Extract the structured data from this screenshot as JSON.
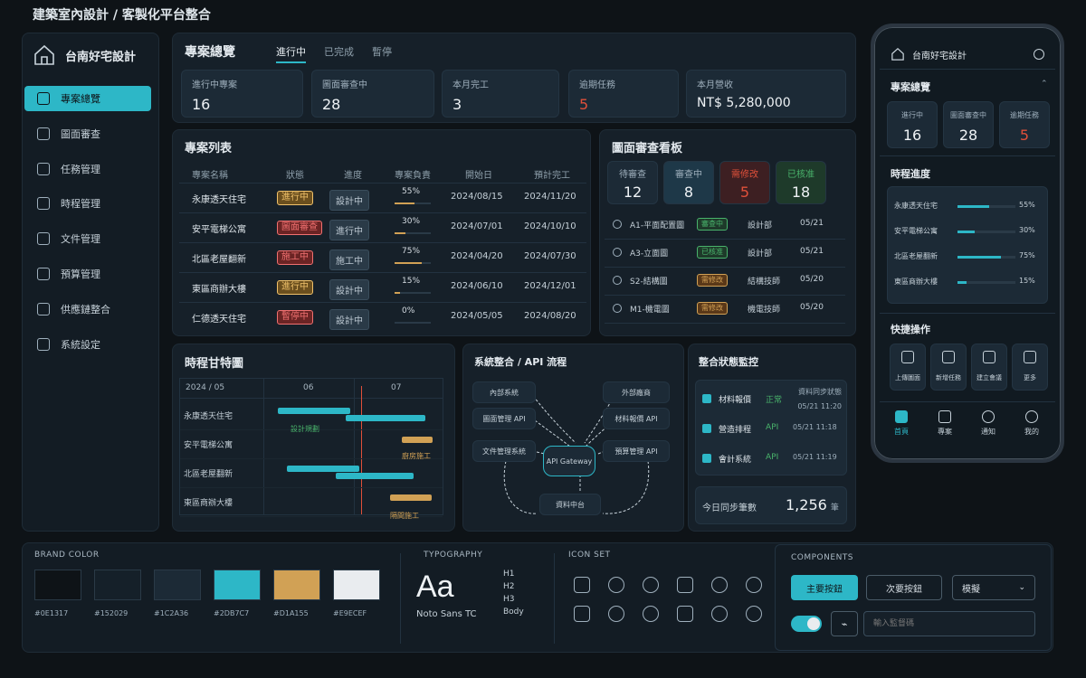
{
  "app": {
    "title": "建築室內設計 / 客製化平台整合"
  },
  "brand": {
    "name": "台南好宅設計"
  },
  "sidebar": {
    "items": [
      {
        "label": "專案總覽",
        "active": true,
        "icon": "dashboard-icon"
      },
      {
        "label": "圖面審查",
        "icon": "document-icon"
      },
      {
        "label": "任務管理",
        "icon": "task-icon"
      },
      {
        "label": "時程管理",
        "icon": "calendar-icon"
      },
      {
        "label": "文件管理",
        "icon": "file-icon"
      },
      {
        "label": "預算管理",
        "icon": "budget-icon"
      },
      {
        "label": "供應鏈整合",
        "icon": "supply-icon"
      },
      {
        "label": "系統設定",
        "icon": "gear-icon"
      }
    ]
  },
  "overview": {
    "title": "專案總覽",
    "tabs": [
      "進行中",
      "已完成",
      "暫停"
    ],
    "stats": [
      {
        "label": "進行中專案",
        "value": "16"
      },
      {
        "label": "圖面審查中",
        "value": "28"
      },
      {
        "label": "本月完工",
        "value": "3"
      },
      {
        "label": "逾期任務",
        "value": "5"
      },
      {
        "label": "本月營收",
        "value": "NT$ 5,280,000"
      }
    ]
  },
  "project_list": {
    "title": "專案列表",
    "columns": [
      "專案名稱",
      "狀態",
      "進度",
      "專案負責",
      "開始日",
      "預計完工"
    ],
    "rows": [
      {
        "name": "永康透天住宅",
        "status": "進行中",
        "phase": "設計中",
        "progress": "55%",
        "pct": 55,
        "start": "2024/08/15",
        "end": "2024/11/20"
      },
      {
        "name": "安平電梯公寓",
        "status": "圖面審查",
        "phase": "進行中",
        "progress": "30%",
        "pct": 30,
        "start": "2024/07/01",
        "end": "2024/10/10"
      },
      {
        "name": "北區老屋翻新",
        "status": "施工中",
        "phase": "施工中",
        "progress": "75%",
        "pct": 75,
        "start": "2024/04/20",
        "end": "2024/07/30"
      },
      {
        "name": "東區商辦大樓",
        "status": "進行中",
        "phase": "設計中",
        "progress": "15%",
        "pct": 15,
        "start": "2024/06/10",
        "end": "2024/12/01"
      },
      {
        "name": "仁德透天住宅",
        "status": "暫停中",
        "phase": "設計中",
        "progress": "0%",
        "pct": 0,
        "start": "2024/05/05",
        "end": "2024/08/20"
      }
    ]
  },
  "review_board": {
    "title": "圖面審查看板",
    "counts": [
      {
        "label": "待審查",
        "value": "12"
      },
      {
        "label": "審查中",
        "value": "8"
      },
      {
        "label": "需修改",
        "value": "5"
      },
      {
        "label": "已核准",
        "value": "18"
      }
    ],
    "items": [
      {
        "code": "A1-平面配置圖",
        "tag": "審查中",
        "dept": "設計部",
        "date": "05/21"
      },
      {
        "code": "A3-立面圖",
        "tag": "已核准",
        "dept": "設計部",
        "date": "05/21"
      },
      {
        "code": "S2-結構圖",
        "tag": "需修改",
        "dept": "結構技師",
        "date": "05/20"
      },
      {
        "code": "M1-機電圖",
        "tag": "需修改",
        "dept": "機電技師",
        "date": "05/20"
      }
    ]
  },
  "gantt": {
    "title": "時程甘特圖",
    "header": [
      "2024 / 05",
      "06",
      "07"
    ],
    "rows": [
      {
        "name": "永康透天住宅",
        "label": "設計規劃"
      },
      {
        "name": "安平電梯公寓",
        "label": "廚房施工"
      },
      {
        "name": "北區老屋翻新",
        "label": ""
      },
      {
        "name": "東區商辦大樓",
        "label": "隔間施工"
      }
    ]
  },
  "api_flow": {
    "title": "系統整合 / API 流程",
    "nodes": {
      "internal": "內部系統",
      "external": "外部廠商",
      "drawing_api": "圖面管理 API",
      "material_api": "材料報價 API",
      "doc_system": "文件管理系統",
      "gateway": "API Gateway",
      "budget_api": "預算管理 API",
      "data_hub": "資料中台"
    }
  },
  "integration": {
    "title": "整合狀態監控",
    "last_sync_label": "資料同步狀態",
    "last_sync_time": "05/21 11:20",
    "rows": [
      {
        "name": "材料報價",
        "type": "正常",
        "time": ""
      },
      {
        "name": "營造排程",
        "type": "API",
        "time": "05/21 11:18"
      },
      {
        "name": "會計系統",
        "type": "API",
        "time": "05/21 11:19"
      }
    ],
    "sync_label": "今日同步筆數",
    "sync_value": "1,256",
    "sync_unit": "筆"
  },
  "mobile": {
    "brand": "台南好宅設計",
    "overview_title": "專案總覽",
    "stats": [
      {
        "label": "進行中",
        "value": "16"
      },
      {
        "label": "圖面審查中",
        "value": "28"
      },
      {
        "label": "逾期任務",
        "value": "5"
      }
    ],
    "progress_title": "時程進度",
    "progress": [
      {
        "name": "永康透天住宅",
        "value": "55%",
        "pct": 55
      },
      {
        "name": "安平電梯公寓",
        "value": "30%",
        "pct": 30
      },
      {
        "name": "北區老屋翻新",
        "value": "75%",
        "pct": 75
      },
      {
        "name": "東區商辦大樓",
        "value": "15%",
        "pct": 15
      }
    ],
    "quick_title": "快捷操作",
    "quick": [
      "上傳圖面",
      "新增任務",
      "建立會議",
      "更多"
    ],
    "tabs": [
      "首頁",
      "專案",
      "通知",
      "我的"
    ]
  },
  "design_system": {
    "brand_color_label": "BRAND COLOR",
    "colors": [
      "#0E1317",
      "#152029",
      "#1C2A36",
      "#2DB7C7",
      "#D1A155",
      "#E9ECEF"
    ],
    "typography_label": "TYPOGRAPHY",
    "type_sample": "Aa",
    "type_font": "Noto Sans TC",
    "type_levels": [
      "H1",
      "H2",
      "H3",
      "Body"
    ],
    "icon_set_label": "ICON SET",
    "components_label": "COMPONENTS",
    "primary_button": "主要按鈕",
    "secondary_button": "次要按鈕",
    "select_value": "模擬",
    "input_placeholder": "輸入監督碼"
  }
}
